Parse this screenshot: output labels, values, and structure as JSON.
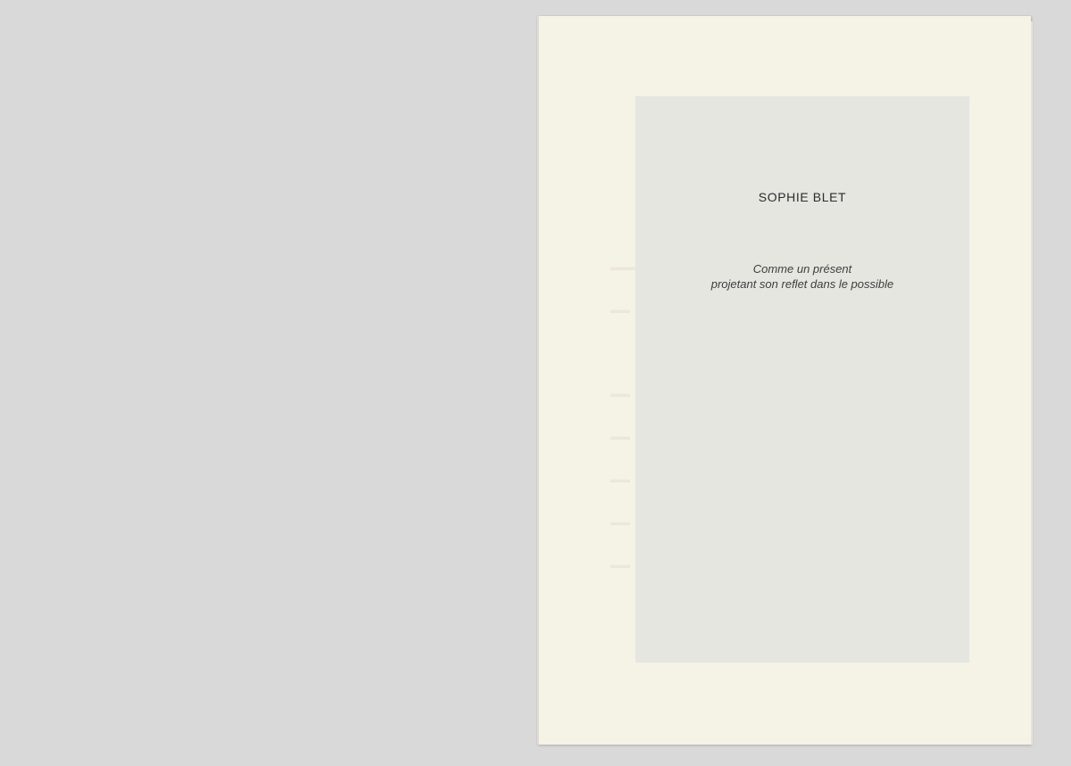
{
  "cover": {
    "author": "SOPHIE BLET",
    "subtitle_lines": [
      "Comme un présent",
      "projetant son reflet dans le possible"
    ]
  },
  "colors": {
    "background": "#d9d9d9",
    "paper": "#f5f2e6",
    "panel": "#e5e6e0",
    "text": "#2c2c2c"
  }
}
